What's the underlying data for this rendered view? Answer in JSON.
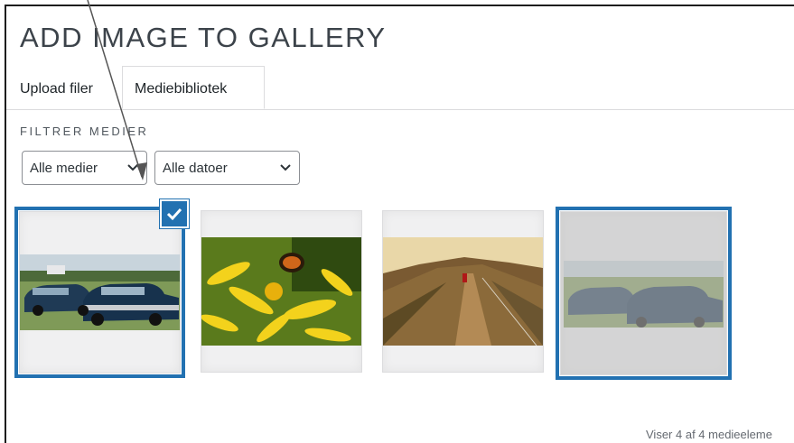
{
  "modal": {
    "title": "ADD IMAGE TO GALLERY",
    "tabs": [
      {
        "label": "Upload filer",
        "active": false
      },
      {
        "label": "Mediebibliotek",
        "active": true
      }
    ],
    "filter": {
      "label": "FILTRER MEDIER",
      "media_select": "Alle medier",
      "date_select": "Alle datoer"
    },
    "thumbnails": [
      {
        "subject": "classic blue cars at a car show",
        "selected": true
      },
      {
        "subject": "bee on yellow flowers",
        "selected": false
      },
      {
        "subject": "cyclist on mountain path",
        "selected": false
      },
      {
        "subject": "classic blue cars at a car show (faded)",
        "selected": true
      }
    ],
    "status": "Viser 4 af 4 medieeleme"
  },
  "colors": {
    "accent": "#2271b1",
    "border": "#dcdcde",
    "text": "#1d2327"
  },
  "icons": {
    "check": "checkmark-icon",
    "dropdown": "chevron-down-icon",
    "annotation": "arrow-annotation-icon"
  }
}
